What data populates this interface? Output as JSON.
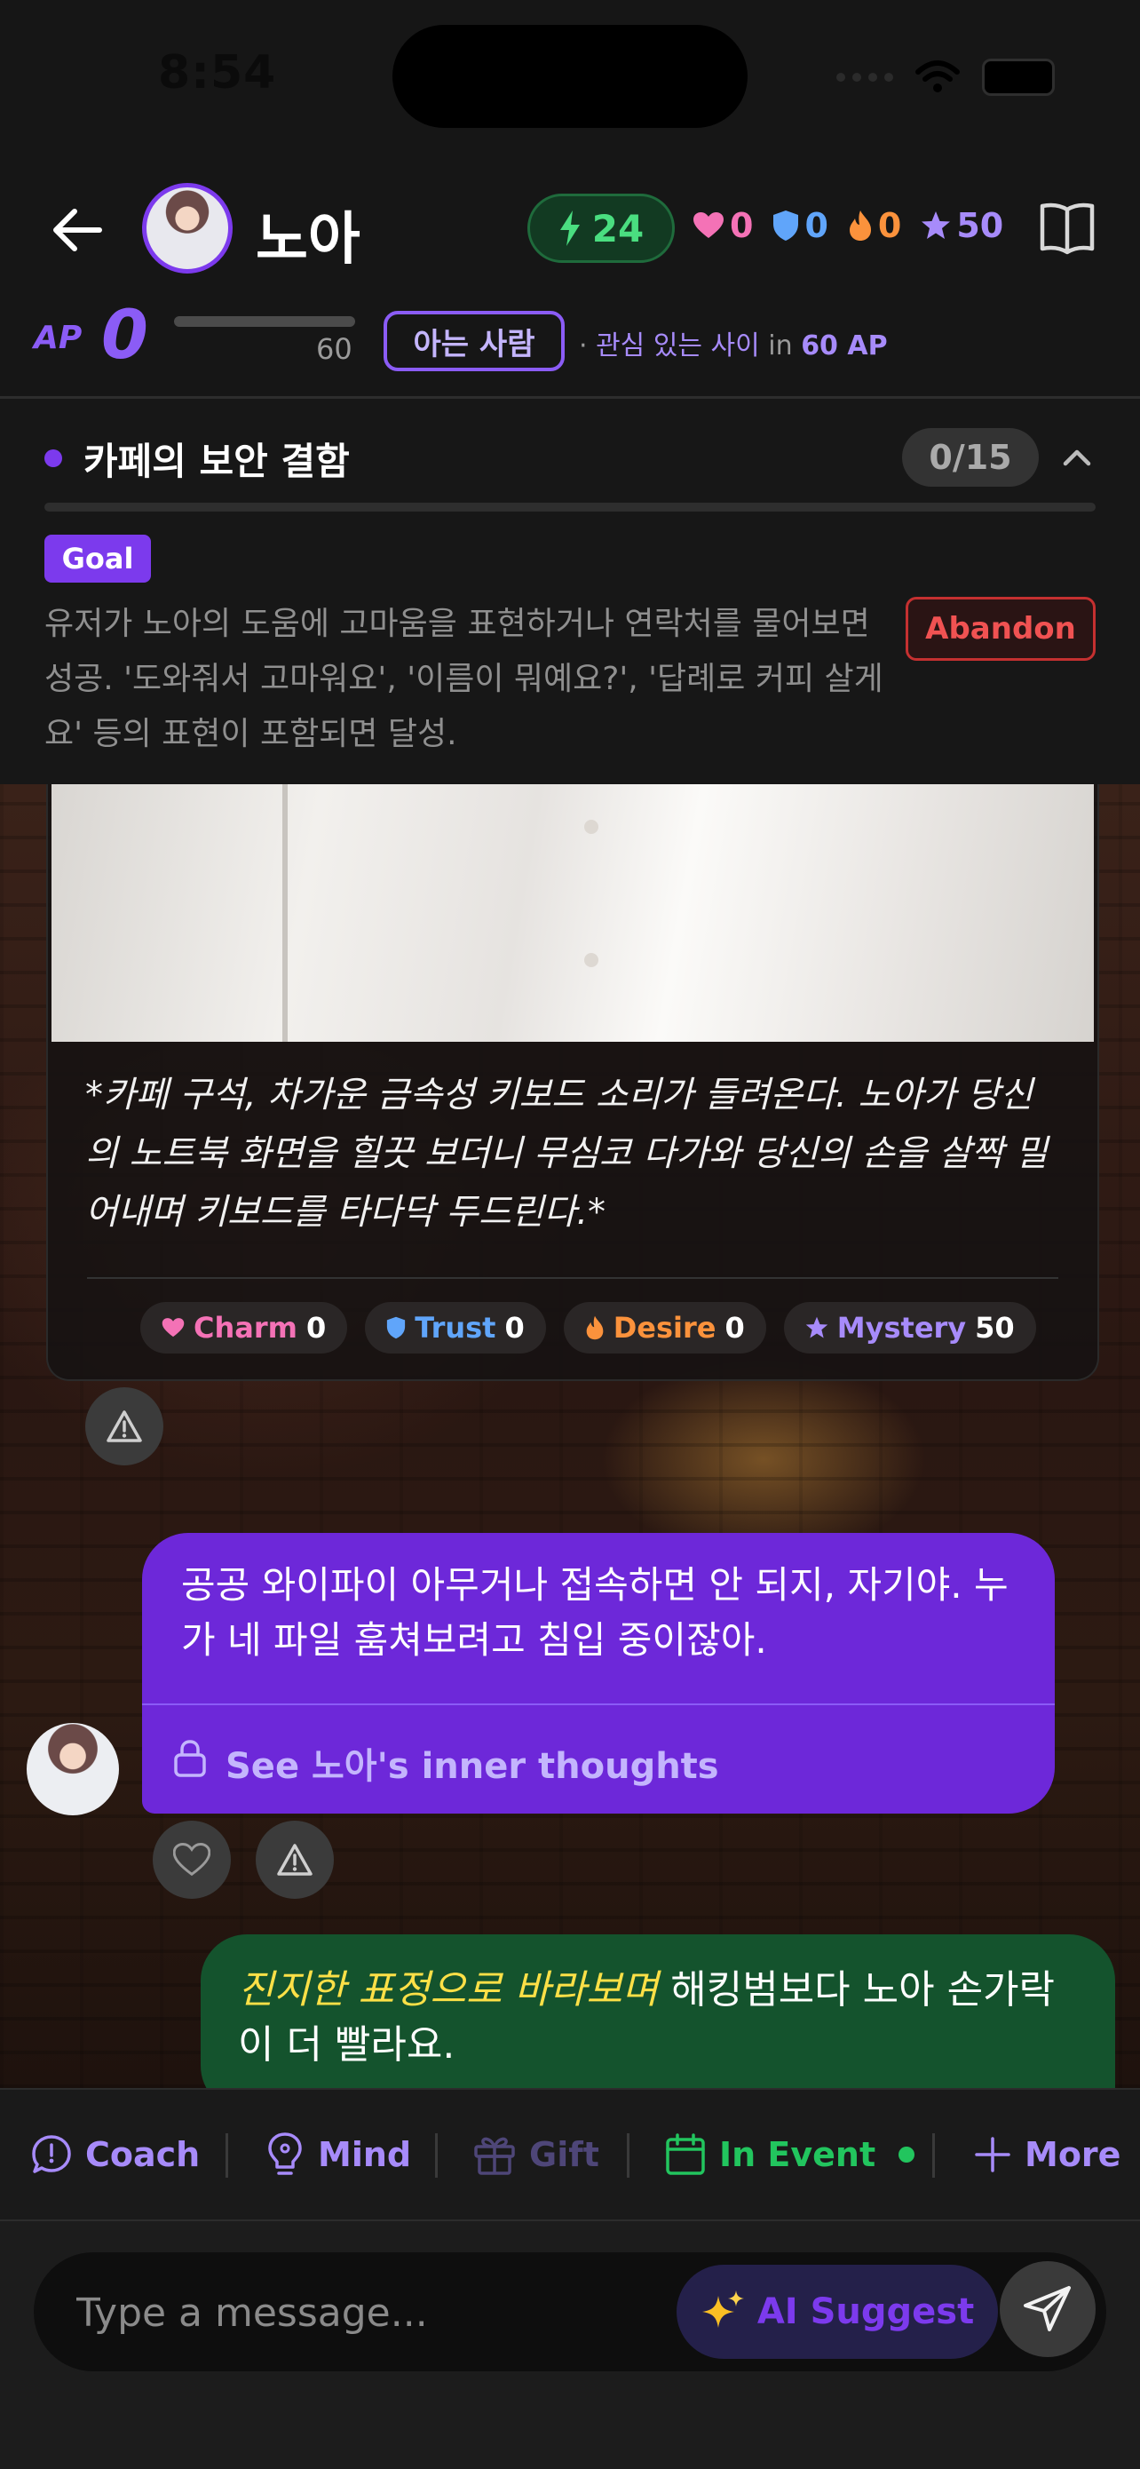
{
  "status_bar": {
    "time": "8:54"
  },
  "header": {
    "name": "노아",
    "energy": "24",
    "stats": {
      "charm": "0",
      "trust": "0",
      "desire": "0",
      "mystery": "50"
    }
  },
  "ap": {
    "label": "AP",
    "value": "0",
    "max": "60",
    "progress": 0,
    "relationship": "아는 사람",
    "next_prefix": "· ",
    "next_relationship": "관심 있는 사이",
    "next_in": " in ",
    "next_ap": "60 AP"
  },
  "quest": {
    "title": "카페의 보안 결함",
    "count": "0/15",
    "progress": 0,
    "goal_label": "Goal",
    "description": "유저가 노아의 도움에 고마움을 표현하거나 연락처를 물어보면 성공. '도와줘서 고마워요', '이름이 뭐예요?', '답례로 커피 살게요' 등의 표현이 포함되면 달성.",
    "abandon_label": "Abandon"
  },
  "scene": {
    "text": "*카페 구석, 차가운 금속성 키보드 소리가 들려온다. 노아가 당신의 노트북 화면을 힐끗 보더니 무심코 다가와 당신의 손을 살짝 밀어내며 키보드를 타다닥 두드린다.*",
    "pills": [
      {
        "label": "Charm",
        "value": "0",
        "color": "#f472b6",
        "icon": "heart-icon"
      },
      {
        "label": "Trust",
        "value": "0",
        "color": "#60a5fa",
        "icon": "shield-icon"
      },
      {
        "label": "Desire",
        "value": "0",
        "color": "#fb923c",
        "icon": "flame-icon"
      },
      {
        "label": "Mystery",
        "value": "50",
        "color": "#a78bfa",
        "icon": "star-icon"
      }
    ]
  },
  "ai_message": {
    "text": "공공 와이파이 아무거나 접속하면 안 되지, 자기야. 누가 네 파일 훔쳐보려고 침입 중이잖아.",
    "thoughts_label": "See 노아's inner thoughts"
  },
  "user_message": {
    "action": "진지한 표정으로 바라보며",
    "text": " 해킹범보다 노아 손가락이 더 빨라요."
  },
  "toolbar": {
    "coach": "Coach",
    "mind": "Mind",
    "gift": "Gift",
    "in_event": "In Event",
    "more": "More"
  },
  "composer": {
    "placeholder": "Type a message...",
    "suggest_label": "AI Suggest"
  },
  "colors": {
    "accent": "#7c3aed",
    "user_bubble": "#14532d",
    "energy": "#4ade80",
    "charm": "#f472b6",
    "trust": "#60a5fa",
    "desire": "#fb923c",
    "mystery": "#a78bfa",
    "abandon": "#f05252"
  }
}
